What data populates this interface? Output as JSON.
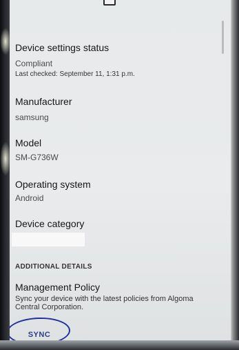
{
  "device_settings": {
    "title": "Device settings status",
    "status": "Compliant",
    "last_checked": "Last checked: September 11, 1:31 p.m."
  },
  "manufacturer": {
    "title": "Manufacturer",
    "value": "samsung"
  },
  "model": {
    "title": "Model",
    "value": "SM-G736W"
  },
  "operating_system": {
    "title": "Operating system",
    "value": "Android"
  },
  "device_category": {
    "title": "Device category"
  },
  "additional_details": {
    "header": "ADDITIONAL DETAILS",
    "policy_title": "Management Policy",
    "policy_description": "Sync your device with the latest policies from Algoma Central Corporation.",
    "sync_label": "SYNC"
  },
  "colors": {
    "screen_bg": "#e8ebec",
    "primary_text": "#161616",
    "accent_button": "#2a3d8a",
    "annotation_circle": "#1f2fa5"
  }
}
